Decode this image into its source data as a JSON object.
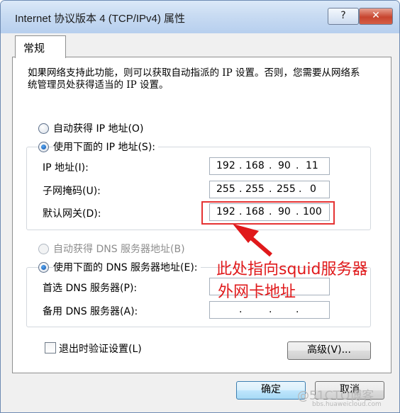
{
  "window": {
    "title": "Internet 协议版本 4 (TCP/IPv4) 属性",
    "help_label": "?",
    "close_label": "✕"
  },
  "tabs": [
    {
      "label": "常规"
    }
  ],
  "description": "如果网络支持此功能，则可以获取自动指派的 IP 设置。否则，您需要从网络系统管理员处获得适当的 IP 设置。",
  "ip_section": {
    "auto_radio_label": "自动获得 IP 地址(O)",
    "manual_radio_label": "使用下面的 IP 地址(S):",
    "selected": "manual",
    "fields": [
      {
        "label": "IP 地址(I):",
        "octets": [
          "192",
          "168",
          "90",
          "11"
        ]
      },
      {
        "label": "子网掩码(U):",
        "octets": [
          "255",
          "255",
          "255",
          "0"
        ]
      },
      {
        "label": "默认网关(D):",
        "octets": [
          "192",
          "168",
          "90",
          "100"
        ]
      }
    ]
  },
  "dns_section": {
    "auto_radio_label": "自动获得 DNS 服务器地址(B)",
    "manual_radio_label": "使用下面的 DNS 服务器地址(E):",
    "selected": "manual",
    "fields": [
      {
        "label": "首选 DNS 服务器(P):",
        "octets": [
          "",
          "",
          "",
          ""
        ]
      },
      {
        "label": "备用 DNS 服务器(A):",
        "octets": [
          "",
          "",
          "",
          ""
        ]
      }
    ]
  },
  "validate_checkbox": {
    "label": "退出时验证设置(L)",
    "checked": false
  },
  "buttons": {
    "advanced": "高级(V)...",
    "ok": "确定",
    "cancel": "取消"
  },
  "annotation": {
    "line1": "此处指向squid服务器",
    "line2": "外网卡地址",
    "color": "#e0191b"
  },
  "watermark": {
    "text": "@51CTO博客",
    "subtext": "bbs.huaweicloud.com"
  }
}
